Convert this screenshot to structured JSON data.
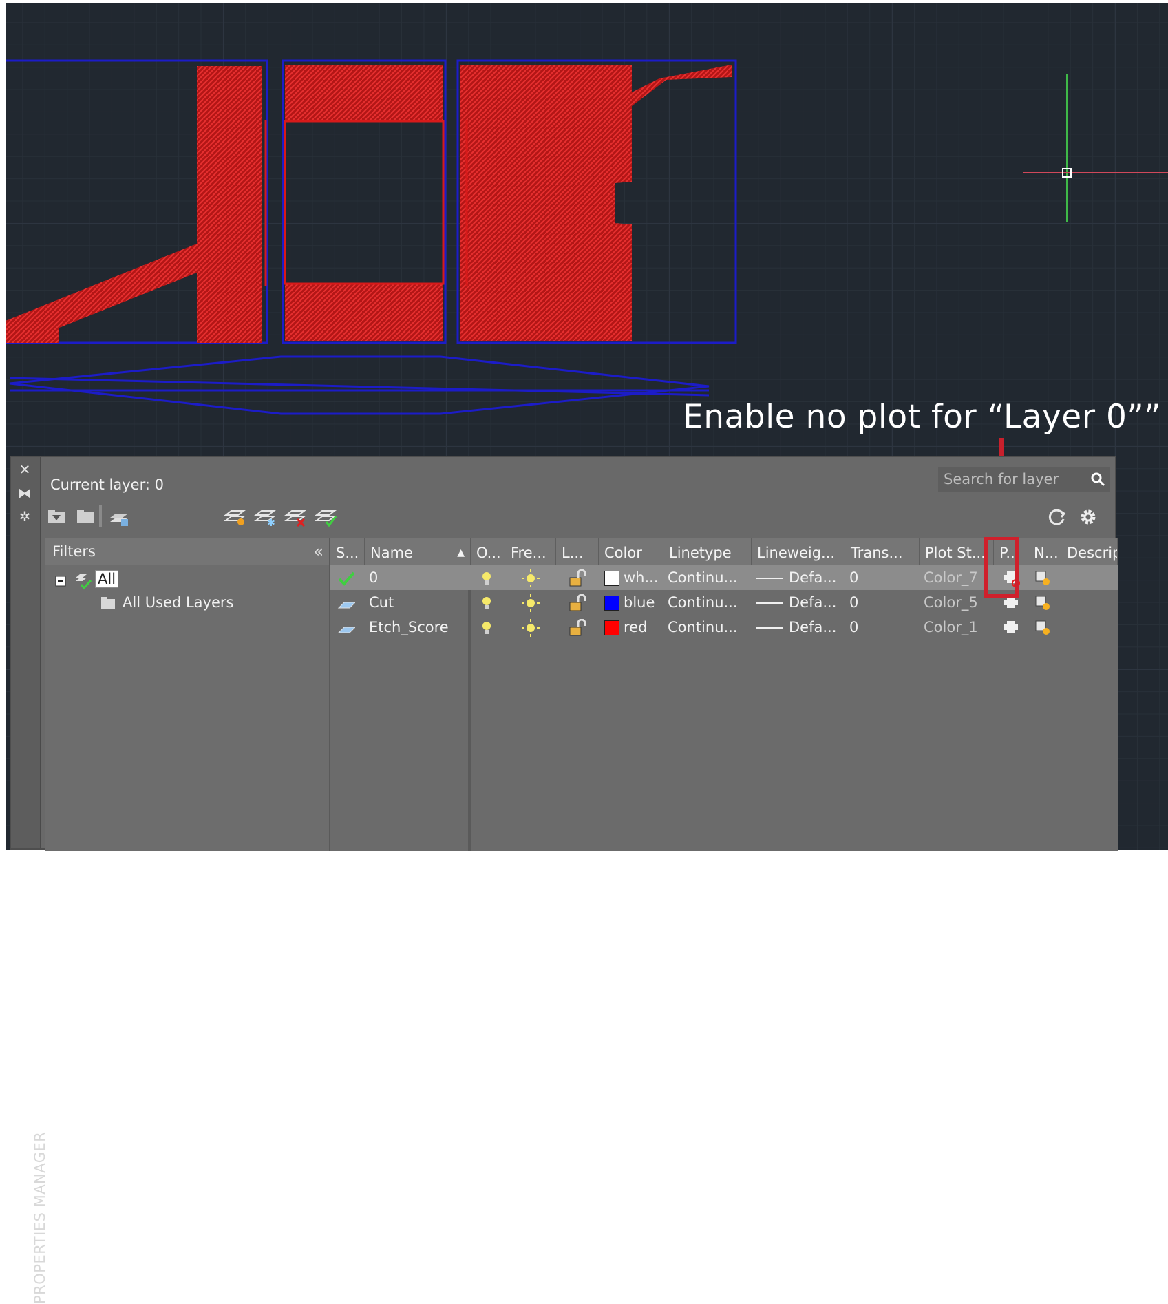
{
  "annotation": {
    "text": "Enable no plot for “Layer 0””"
  },
  "palette": {
    "side_title": "PROPERTIES MANAGER",
    "current_layer": "Current layer: 0",
    "search_placeholder": "Search for layer",
    "filters": {
      "header": "Filters",
      "collapse": "«",
      "tree": [
        {
          "label": "All"
        },
        {
          "label": "All Used Layers"
        }
      ]
    },
    "columns": [
      "S...",
      "Name",
      "O...",
      "Fre...",
      "L...",
      "Color",
      "Linetype",
      "Lineweig...",
      "Trans...",
      "Plot St...",
      "P...",
      "N...",
      "Descrip"
    ],
    "layers": [
      {
        "status_icon": "current-checkmark-icon",
        "name": "0",
        "on": "lightbulb-icon",
        "freeze": "sun-icon",
        "lock": "unlock-icon",
        "color_name": "wh...",
        "color_hex": "#ffffff",
        "linetype": "Continu...",
        "lineweight": "Defa...",
        "transparency": "0",
        "plot_style": "Color_7",
        "plot_icon": "no-plot-printer-icon",
        "new_vp_freeze": "new-vp-freeze-icon",
        "selected": true
      },
      {
        "status_icon": "layer-parallelogram-icon",
        "name": "Cut",
        "on": "lightbulb-icon",
        "freeze": "sun-icon",
        "lock": "unlock-icon",
        "color_name": "blue",
        "color_hex": "#0000ff",
        "linetype": "Continu...",
        "lineweight": "Defa...",
        "transparency": "0",
        "plot_style": "Color_5",
        "plot_icon": "printer-icon",
        "new_vp_freeze": "new-vp-freeze-icon",
        "selected": false
      },
      {
        "status_icon": "layer-parallelogram-icon",
        "name": "Etch_Score",
        "on": "lightbulb-icon",
        "freeze": "sun-icon",
        "lock": "unlock-icon",
        "color_name": "red",
        "color_hex": "#ff0000",
        "linetype": "Continu...",
        "lineweight": "Defa...",
        "transparency": "0",
        "plot_style": "Color_1",
        "plot_icon": "printer-icon",
        "new_vp_freeze": "new-vp-freeze-icon",
        "selected": false
      }
    ]
  },
  "colors": {
    "accent_red": "#c8202c",
    "outline_blue": "#1c1cc8",
    "hatch_red": "#cc1a1a",
    "canvas_bg": "#212830"
  }
}
